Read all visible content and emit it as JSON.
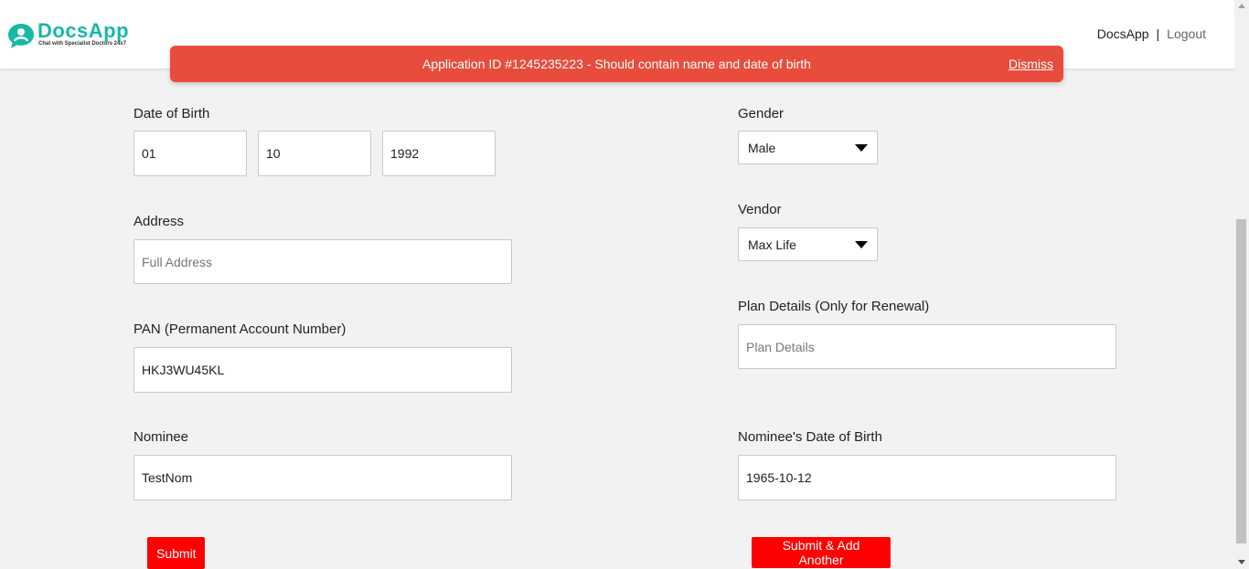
{
  "header": {
    "logo_text": "DocsApp",
    "logo_tagline": "Chat with Specialist Doctors 24x7",
    "nav_brand": "DocsApp",
    "nav_separator": "|",
    "nav_logout": "Logout"
  },
  "alert": {
    "message": "Application ID #1245235223 - Should contain name and date of birth",
    "dismiss_label": "Dismiss",
    "color": "#e84c3d"
  },
  "form": {
    "dob": {
      "label": "Date of Birth",
      "day": "01",
      "month": "10",
      "year": "1992"
    },
    "address": {
      "label": "Address",
      "value": "",
      "placeholder": "Full Address"
    },
    "pan": {
      "label": "PAN (Permanent Account Number)",
      "value": "HKJ3WU45KL"
    },
    "nominee": {
      "label": "Nominee",
      "value": "TestNom"
    },
    "gender": {
      "label": "Gender",
      "selected": "Male"
    },
    "vendor": {
      "label": "Vendor",
      "selected": "Max Life"
    },
    "plan": {
      "label": "Plan Details (Only for Renewal)",
      "value": "",
      "placeholder": "Plan Details"
    },
    "nominee_dob": {
      "label": "Nominee's Date of Birth",
      "value": "1965-10-12"
    }
  },
  "buttons": {
    "submit": "Submit",
    "submit_add": "Submit & Add Another",
    "color": "#ff0000"
  },
  "icons": {
    "logo": "chat-bubble-doctor-icon",
    "dropdown": "caret-down-icon"
  }
}
